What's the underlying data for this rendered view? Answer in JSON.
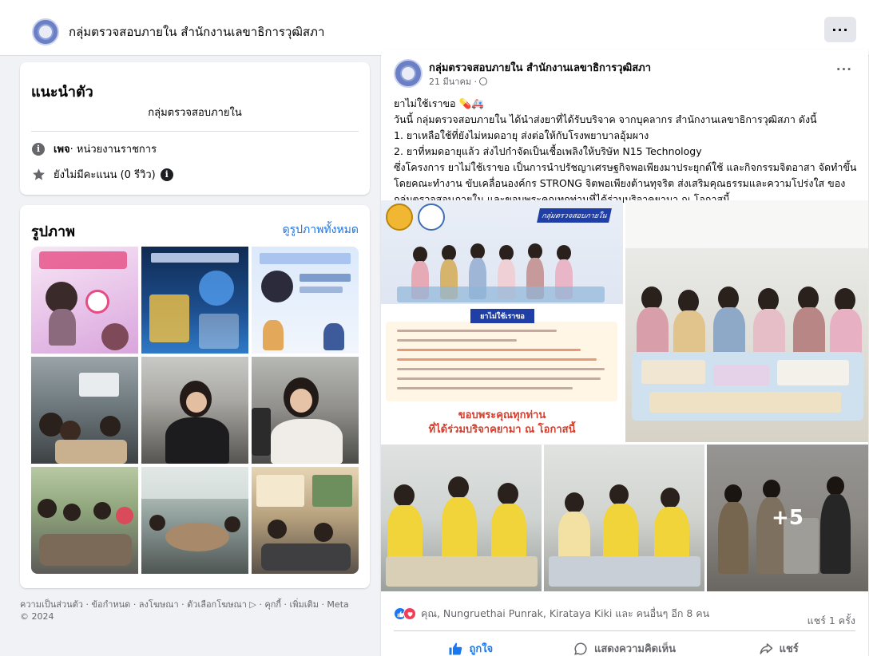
{
  "header": {
    "page_name": "กลุ่มตรวจสอบภายใน สำนักงานเลขาธิการวุฒิสภา",
    "more_label": "···"
  },
  "intro": {
    "title": "แนะนำตัว",
    "bio": "กลุ่มตรวจสอบภายใน",
    "category_label": "เพจ",
    "category_value": " · หน่วยงานราชการ",
    "rating": "ยังไม่มีคะแนน (0 รีวิว)"
  },
  "photos": {
    "title": "รูปภาพ",
    "see_all": "ดูรูปภาพทั้งหมด"
  },
  "footer": {
    "text": "ความเป็นส่วนตัว · ข้อกำหนด · ลงโฆษณา · ตัวเลือกโฆษณา ▷ · คุกกี้ · เพิ่มเติม · Meta © 2024"
  },
  "post": {
    "author": "กลุ่มตรวจสอบภายใน สำนักงานเลขาธิการวุฒิสภา",
    "date": "21 มีนาคม · ",
    "more_label": "···",
    "lines": [
      "ยาไม่ใช้เราขอ 💊🚑",
      "วันนี้ กลุ่มตรวจสอบภายใน ได้นำส่งยาที่ได้รับบริจาค จากบุคลากร สำนักงานเลขาธิการวุฒิสภา ดังนี้",
      "1. ยาเหลือใช้ที่ยังไม่หมดอายุ ส่งต่อให้กับโรงพยาบาลอุ้มผาง",
      "2. ยาที่หมดอายุแล้ว ส่งไปกำจัดเป็นเชื้อเพลิงให้บริษัท N15 Technology",
      "ซึ่งโครงการ ยาไม่ใช้เราขอ เป็นการนำปรัชญาเศรษฐกิจพอเพียงมาประยุกต์ใช้ และกิจกรรมจิตอาสา จัดทำขึ้น",
      "โดยคณะทำงาน ขับเคลื่อนองค์กร STRONG จิตพอเพียงต้านทุจริต ส่งเสริมคุณธรรมและความโปร่งใส ของ",
      "กลุ่มตรวจสอบภายใน และขอบพระคุณทุกท่านที่ได้ร่วมบริจาคยามา ณ โอกาสนี้"
    ],
    "poster": {
      "tag": "กลุ่มตรวจสอบภายใน",
      "headline": "ยาไม่ใช้เราขอ",
      "thanks_line1": "ขอบพระคุณทุกท่าน",
      "thanks_line2": "ที่ได้ร่วมบริจาคยามา ณ โอกาสนี้"
    },
    "more_photos": "+5",
    "reactions_text": "คุณ, Nungruethai Punrak, Kirataya Kiki และ คนอื่นๆ อีก 8 คน",
    "share_count": "แชร์ 1 ครั้ง",
    "actions": {
      "like": "ถูกใจ",
      "comment": "แสดงความคิดเห็น",
      "share": "แชร์"
    }
  },
  "colors": {
    "accent": "#1877f2",
    "link": "#1b74e4",
    "background": "#f0f2f5",
    "secondary_text": "#65676b"
  }
}
